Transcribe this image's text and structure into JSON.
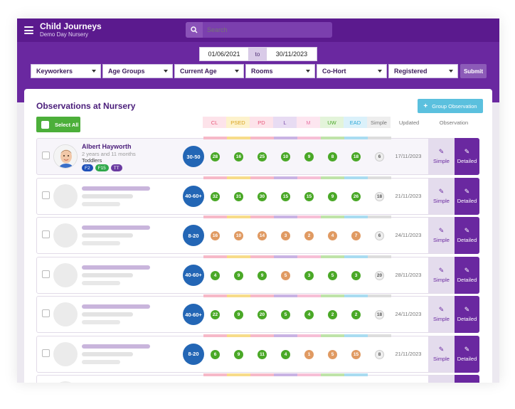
{
  "app": {
    "title": "Child Journeys",
    "subtitle": "Demo Day Nursery"
  },
  "search": {
    "placeholder": "Search"
  },
  "dates": {
    "from": "01/06/2021",
    "separator": "to",
    "to": "30/11/2023"
  },
  "filters": [
    "Keyworkers",
    "Age Groups",
    "Current Age",
    "Rooms",
    "Co-Hort",
    "Registered"
  ],
  "submit_label": "Submit",
  "page": {
    "title": "Observations at Nursery",
    "group_button": "Group Observation",
    "select_all": "Select All"
  },
  "columns": {
    "areas": [
      {
        "label": "CL",
        "color": "#e8577a",
        "bg": "#fde3ea",
        "stripe": "#f6b9c8"
      },
      {
        "label": "PSED",
        "color": "#d9a520",
        "bg": "#fdf2cc",
        "stripe": "#f7dc8a"
      },
      {
        "label": "PD",
        "color": "#e8577a",
        "bg": "#fde3ea",
        "stripe": "#f6b9c8"
      },
      {
        "label": "L",
        "color": "#7a4ca8",
        "bg": "#e8dcf3",
        "stripe": "#c9b3e3"
      },
      {
        "label": "M",
        "color": "#e87aa8",
        "bg": "#fde6f0",
        "stripe": "#f6bfd6"
      },
      {
        "label": "UW",
        "color": "#4aa827",
        "bg": "#e3f4da",
        "stripe": "#bfe3a9"
      },
      {
        "label": "EAD",
        "color": "#2fa8d8",
        "bg": "#dbf1fa",
        "stripe": "#a9dcf1"
      }
    ],
    "simple": "Simple",
    "updated": "Updated",
    "observation": "Observation"
  },
  "buttons": {
    "simple": "Simple",
    "detailed": "Detailed"
  },
  "icons": {
    "menu": "hamburger-icon",
    "search": "search-icon",
    "plus": "plus-icon",
    "edit": "pencil-icon"
  },
  "rows": [
    {
      "name": "Albert Hayworth",
      "age": "2 years and 11 months",
      "group": "Toddlers",
      "tags": [
        {
          "label": "F2",
          "color": "#1e4fb8"
        },
        {
          "label": "F15",
          "color": "#2fa84a"
        },
        {
          "label": "TT",
          "color": "#6a3aa0"
        }
      ],
      "band": "30-50",
      "scores": [
        {
          "v": "28",
          "c": "g"
        },
        {
          "v": "16",
          "c": "g"
        },
        {
          "v": "25",
          "c": "g"
        },
        {
          "v": "10",
          "c": "g"
        },
        {
          "v": "9",
          "c": "g"
        },
        {
          "v": "8",
          "c": "g"
        },
        {
          "v": "18",
          "c": "g"
        }
      ],
      "simple": "6",
      "updated": "17/11/2023"
    },
    {
      "band": "40-60+",
      "scores": [
        {
          "v": "32",
          "c": "g"
        },
        {
          "v": "31",
          "c": "g"
        },
        {
          "v": "30",
          "c": "g"
        },
        {
          "v": "15",
          "c": "g"
        },
        {
          "v": "15",
          "c": "g"
        },
        {
          "v": "9",
          "c": "g"
        },
        {
          "v": "26",
          "c": "g"
        }
      ],
      "simple": "18",
      "updated": "21/11/2023"
    },
    {
      "band": "8-20",
      "scores": [
        {
          "v": "16",
          "c": "o"
        },
        {
          "v": "10",
          "c": "o"
        },
        {
          "v": "14",
          "c": "o"
        },
        {
          "v": "3",
          "c": "o"
        },
        {
          "v": "2",
          "c": "o"
        },
        {
          "v": "4",
          "c": "o"
        },
        {
          "v": "7",
          "c": "o"
        }
      ],
      "simple": "6",
      "updated": "24/11/2023"
    },
    {
      "band": "40-60+",
      "scores": [
        {
          "v": "4",
          "c": "g"
        },
        {
          "v": "9",
          "c": "g"
        },
        {
          "v": "9",
          "c": "g"
        },
        {
          "v": "5",
          "c": "o"
        },
        {
          "v": "3",
          "c": "g"
        },
        {
          "v": "5",
          "c": "g"
        },
        {
          "v": "3",
          "c": "g"
        }
      ],
      "simple": "20",
      "updated": "28/11/2023"
    },
    {
      "band": "40-60+",
      "scores": [
        {
          "v": "22",
          "c": "g"
        },
        {
          "v": "9",
          "c": "g"
        },
        {
          "v": "20",
          "c": "g"
        },
        {
          "v": "5",
          "c": "g"
        },
        {
          "v": "4",
          "c": "g"
        },
        {
          "v": "2",
          "c": "g"
        },
        {
          "v": "2",
          "c": "g"
        }
      ],
      "simple": "18",
      "updated": "24/11/2023"
    },
    {
      "band": "8-20",
      "scores": [
        {
          "v": "6",
          "c": "g"
        },
        {
          "v": "9",
          "c": "g"
        },
        {
          "v": "11",
          "c": "g"
        },
        {
          "v": "4",
          "c": "g"
        },
        {
          "v": "1",
          "c": "o"
        },
        {
          "v": "5",
          "c": "o"
        },
        {
          "v": "15",
          "c": "o"
        }
      ],
      "simple": "8",
      "updated": "21/11/2023"
    }
  ]
}
